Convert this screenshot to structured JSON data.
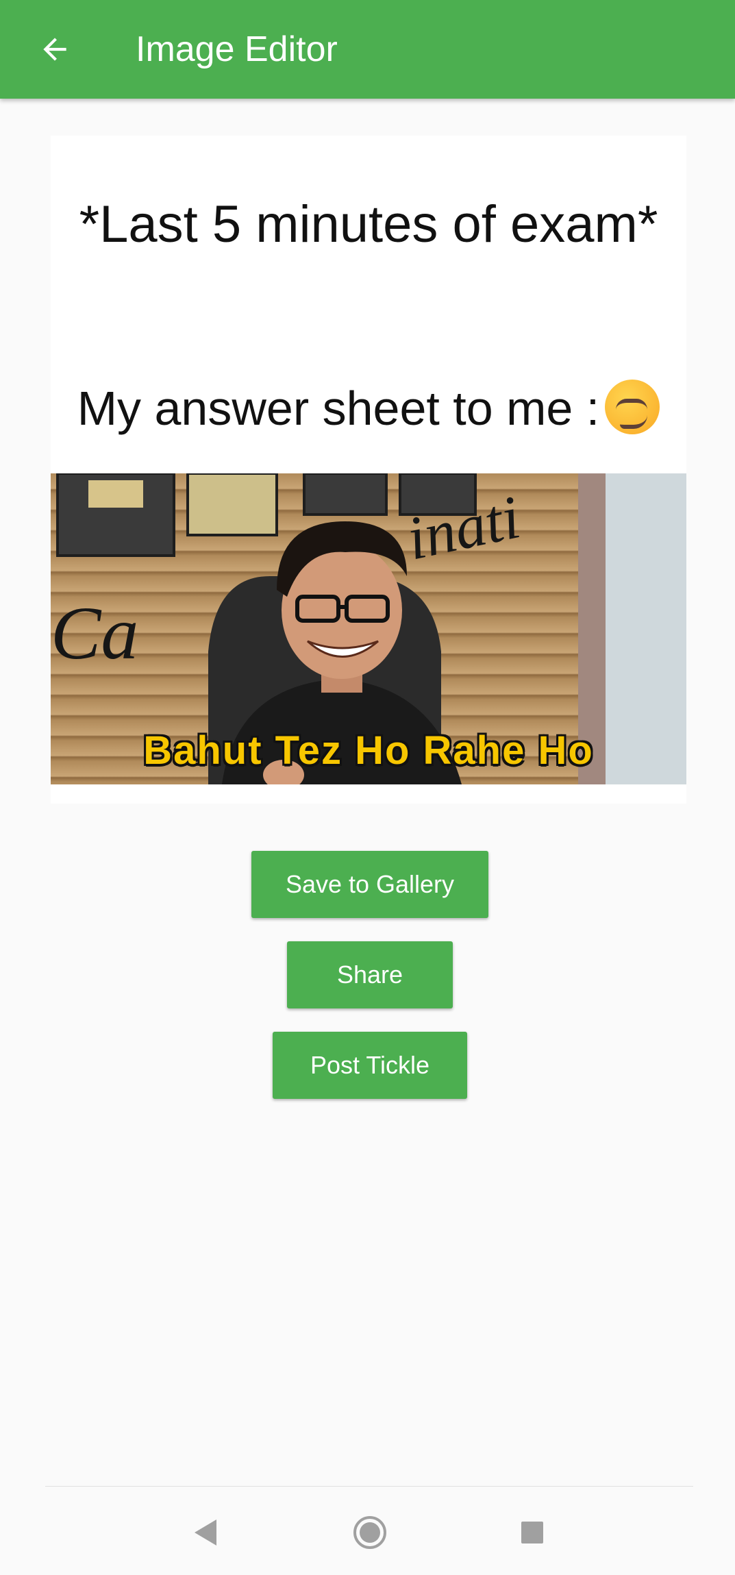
{
  "appbar": {
    "title": "Image Editor",
    "back_icon": "arrow-back-icon",
    "color": "#4caf50"
  },
  "meme": {
    "line1": "*Last 5 minutes of exam*",
    "line2": "My answer sheet to me :",
    "emoji": "smirking-face-emoji",
    "caption": "Bahut Tez Ho Rahe Ho"
  },
  "actions": {
    "save_label": "Save to Gallery",
    "share_label": "Share",
    "post_label": "Post Tickle"
  },
  "navbar": {
    "back_icon": "nav-back-icon",
    "home_icon": "nav-home-icon",
    "recents_icon": "nav-recents-icon"
  }
}
